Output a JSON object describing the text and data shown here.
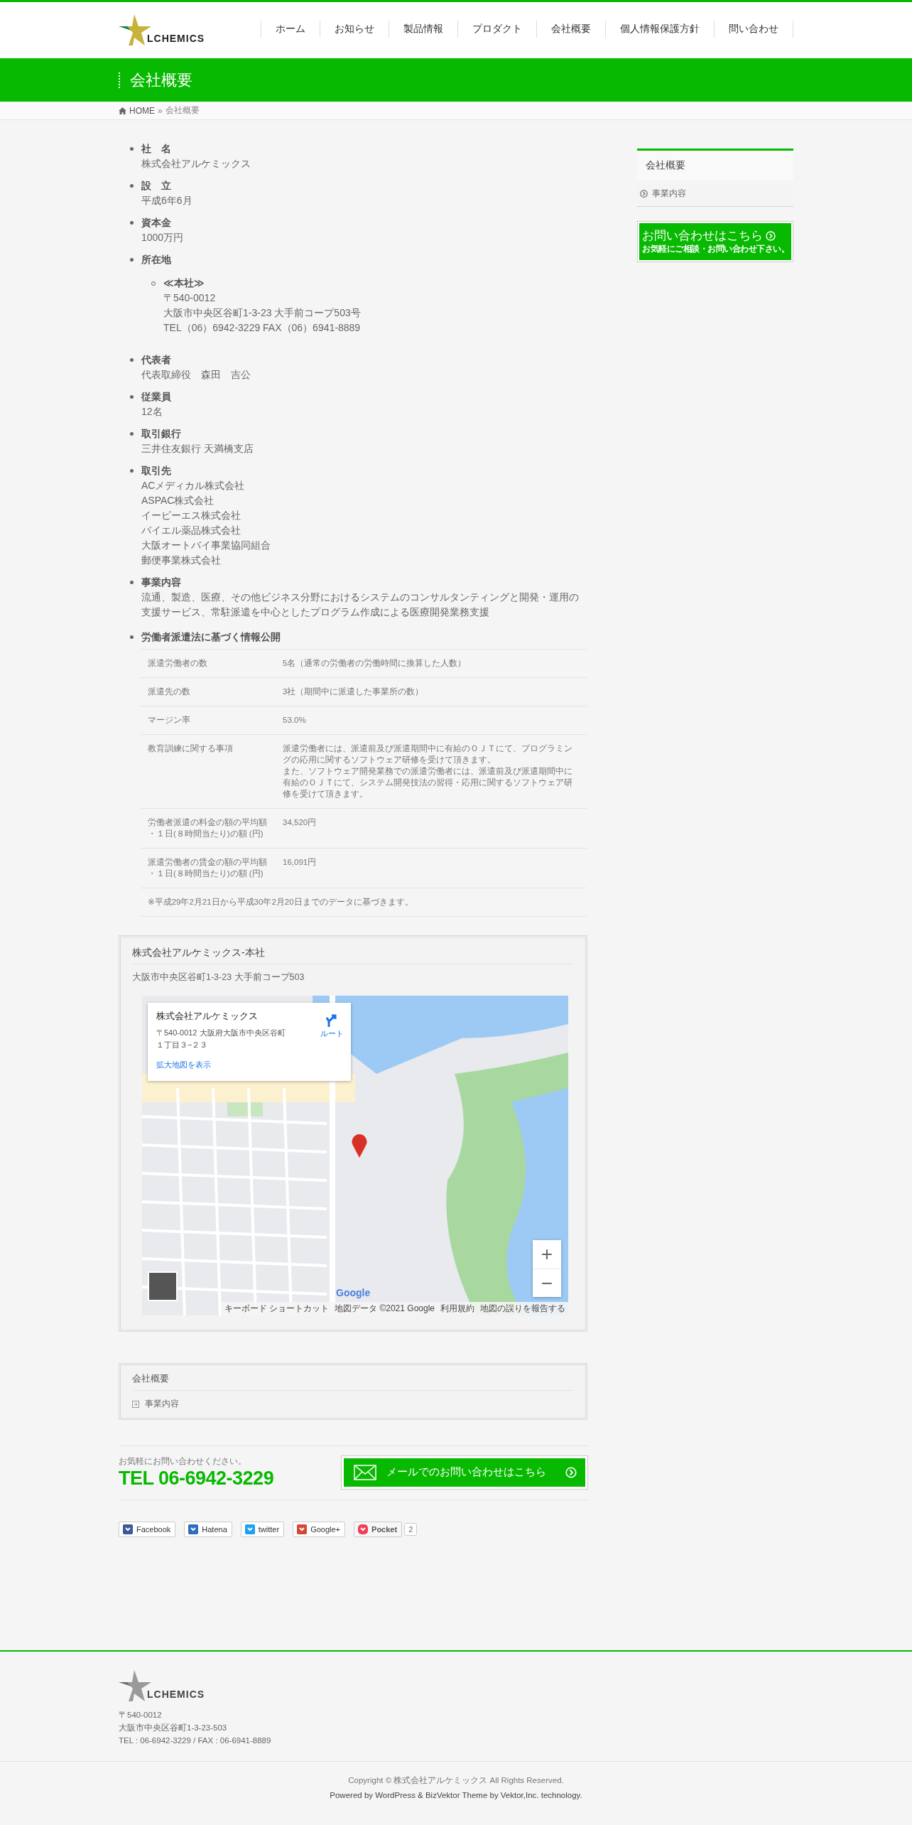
{
  "header": {
    "logo_text": "LCHEMICS",
    "nav": [
      "ホーム",
      "お知らせ",
      "製品情報",
      "プロダクト",
      "会社概要",
      "個人情報保護方針",
      "問い合わせ"
    ]
  },
  "page_title": "会社概要",
  "breadcrumb": {
    "home": "HOME",
    "separator": "»",
    "current": "会社概要"
  },
  "profile": [
    {
      "label": "社　名",
      "values": [
        "株式会社アルケミックス"
      ]
    },
    {
      "label": "設　立",
      "values": [
        "平成6年6月"
      ]
    },
    {
      "label": "資本金",
      "values": [
        "1000万円"
      ]
    },
    {
      "label": "所在地",
      "children": [
        {
          "label": "≪本社≫",
          "values": [
            "〒540-0012",
            "大阪市中央区谷町1-3-23 大手前コープ503号",
            "TEL（06）6942-3229 FAX（06）6941-8889"
          ]
        }
      ]
    },
    {
      "label": "代表者",
      "values": [
        "代表取締役　森田　吉公"
      ]
    },
    {
      "label": "従業員",
      "values": [
        "12名"
      ]
    },
    {
      "label": "取引銀行",
      "values": [
        "三井住友銀行 天満橋支店"
      ]
    },
    {
      "label": "取引先",
      "values": [
        "ACメディカル株式会社",
        "ASPAC株式会社",
        "イーピーエス株式会社",
        "バイエル薬品株式会社",
        "大阪オートバイ事業協同組合",
        "郵便事業株式会社"
      ]
    },
    {
      "label": "事業内容",
      "values": [
        "流通、製造、医療、その他ビジネス分野におけるシステムのコンサルタンティングと開発・運用の支援サービス、常駐派遣を中心としたプログラム作成による医療開発業務支援"
      ]
    }
  ],
  "disclosure": {
    "heading": "労働者派遣法に基づく情報公開",
    "rows": [
      {
        "label": [
          "派遣労働者の数"
        ],
        "value": [
          "5名（通常の労働者の労働時間に換算した人数）"
        ]
      },
      {
        "label": [
          "派遣先の数"
        ],
        "value": [
          "3社（期間中に派遣した事業所の数）"
        ]
      },
      {
        "label": [
          "マージン率"
        ],
        "value": [
          "53.0%"
        ]
      },
      {
        "label": [
          "教育訓練に関する事項"
        ],
        "value": [
          "派遣労働者には、派遣前及び派遣期間中に有給のＯＪＴにて、プログラミングの応用に関するソフトウェア研修を受けて頂きます。",
          "また、ソフトウェア開発業務での派遣労働者には、派遣前及び派遣期間中に有給のＯＪＴにて、システム開発技法の習得・応用に関するソフトウェア研修を受けて頂きます。"
        ]
      },
      {
        "label": [
          "労働者派遣の料金の額の平均額",
          "・１日(８時間当たり)の額 (円)"
        ],
        "value": [
          "34,520円"
        ]
      },
      {
        "label": [
          "派遣労働者の賃金の額の平均額",
          "・１日(８時間当たり)の額 (円)"
        ],
        "value": [
          "16,091円"
        ]
      }
    ],
    "note": "※平成29年2月21日から平成30年2月20日までのデータに基づきます。"
  },
  "map_card": {
    "title": "株式会社アルケミックス-本社",
    "address": "大阪市中央区谷町1-3-23 大手前コープ503",
    "info": {
      "name": "株式会社アルケミックス",
      "address": [
        "〒540-0012 大阪府大阪市中央区谷町",
        "１丁目３−２３"
      ],
      "route": "ルート",
      "link": "拡大地図を表示"
    },
    "zoom_in": "+",
    "zoom_out": "−",
    "logo": "Google",
    "attribution": [
      "キーボード ショートカット",
      "地図データ ©2021 Google",
      "利用規約",
      "地図の誤りを報告する"
    ]
  },
  "widget": {
    "title": "会社概要",
    "items": [
      "事業内容"
    ]
  },
  "contact": {
    "note": "お気軽にお問い合わせください。",
    "tel": "TEL 06-6942-3229",
    "button": "メールでのお問い合わせはこちら"
  },
  "social": [
    {
      "kind": "facebook",
      "label": "Facebook"
    },
    {
      "kind": "hatena",
      "label": "Hatena"
    },
    {
      "kind": "twitter",
      "label": "twitter"
    },
    {
      "kind": "google",
      "label": "Google+"
    },
    {
      "kind": "pocket",
      "label": "Pocket",
      "count": "2"
    }
  ],
  "sidebar": {
    "title": "会社概要",
    "items": [
      "事業内容"
    ],
    "banner": {
      "title": "お問い合わせはこちら",
      "subtitle": "お気軽にご相談・お問い合わせ下さい。"
    }
  },
  "footer": {
    "logo_text": "LCHEMICS",
    "address": [
      "〒540-0012",
      "大阪市中央区谷町1-3-23-503",
      "TEL : 06-6942-3229 / FAX : 06-6941-8889"
    ],
    "copyright": "Copyright © 株式会社アルケミックス All Rights Reserved.",
    "powered": "Powered by WordPress & BizVektor Theme by Vektor,Inc. technology."
  }
}
